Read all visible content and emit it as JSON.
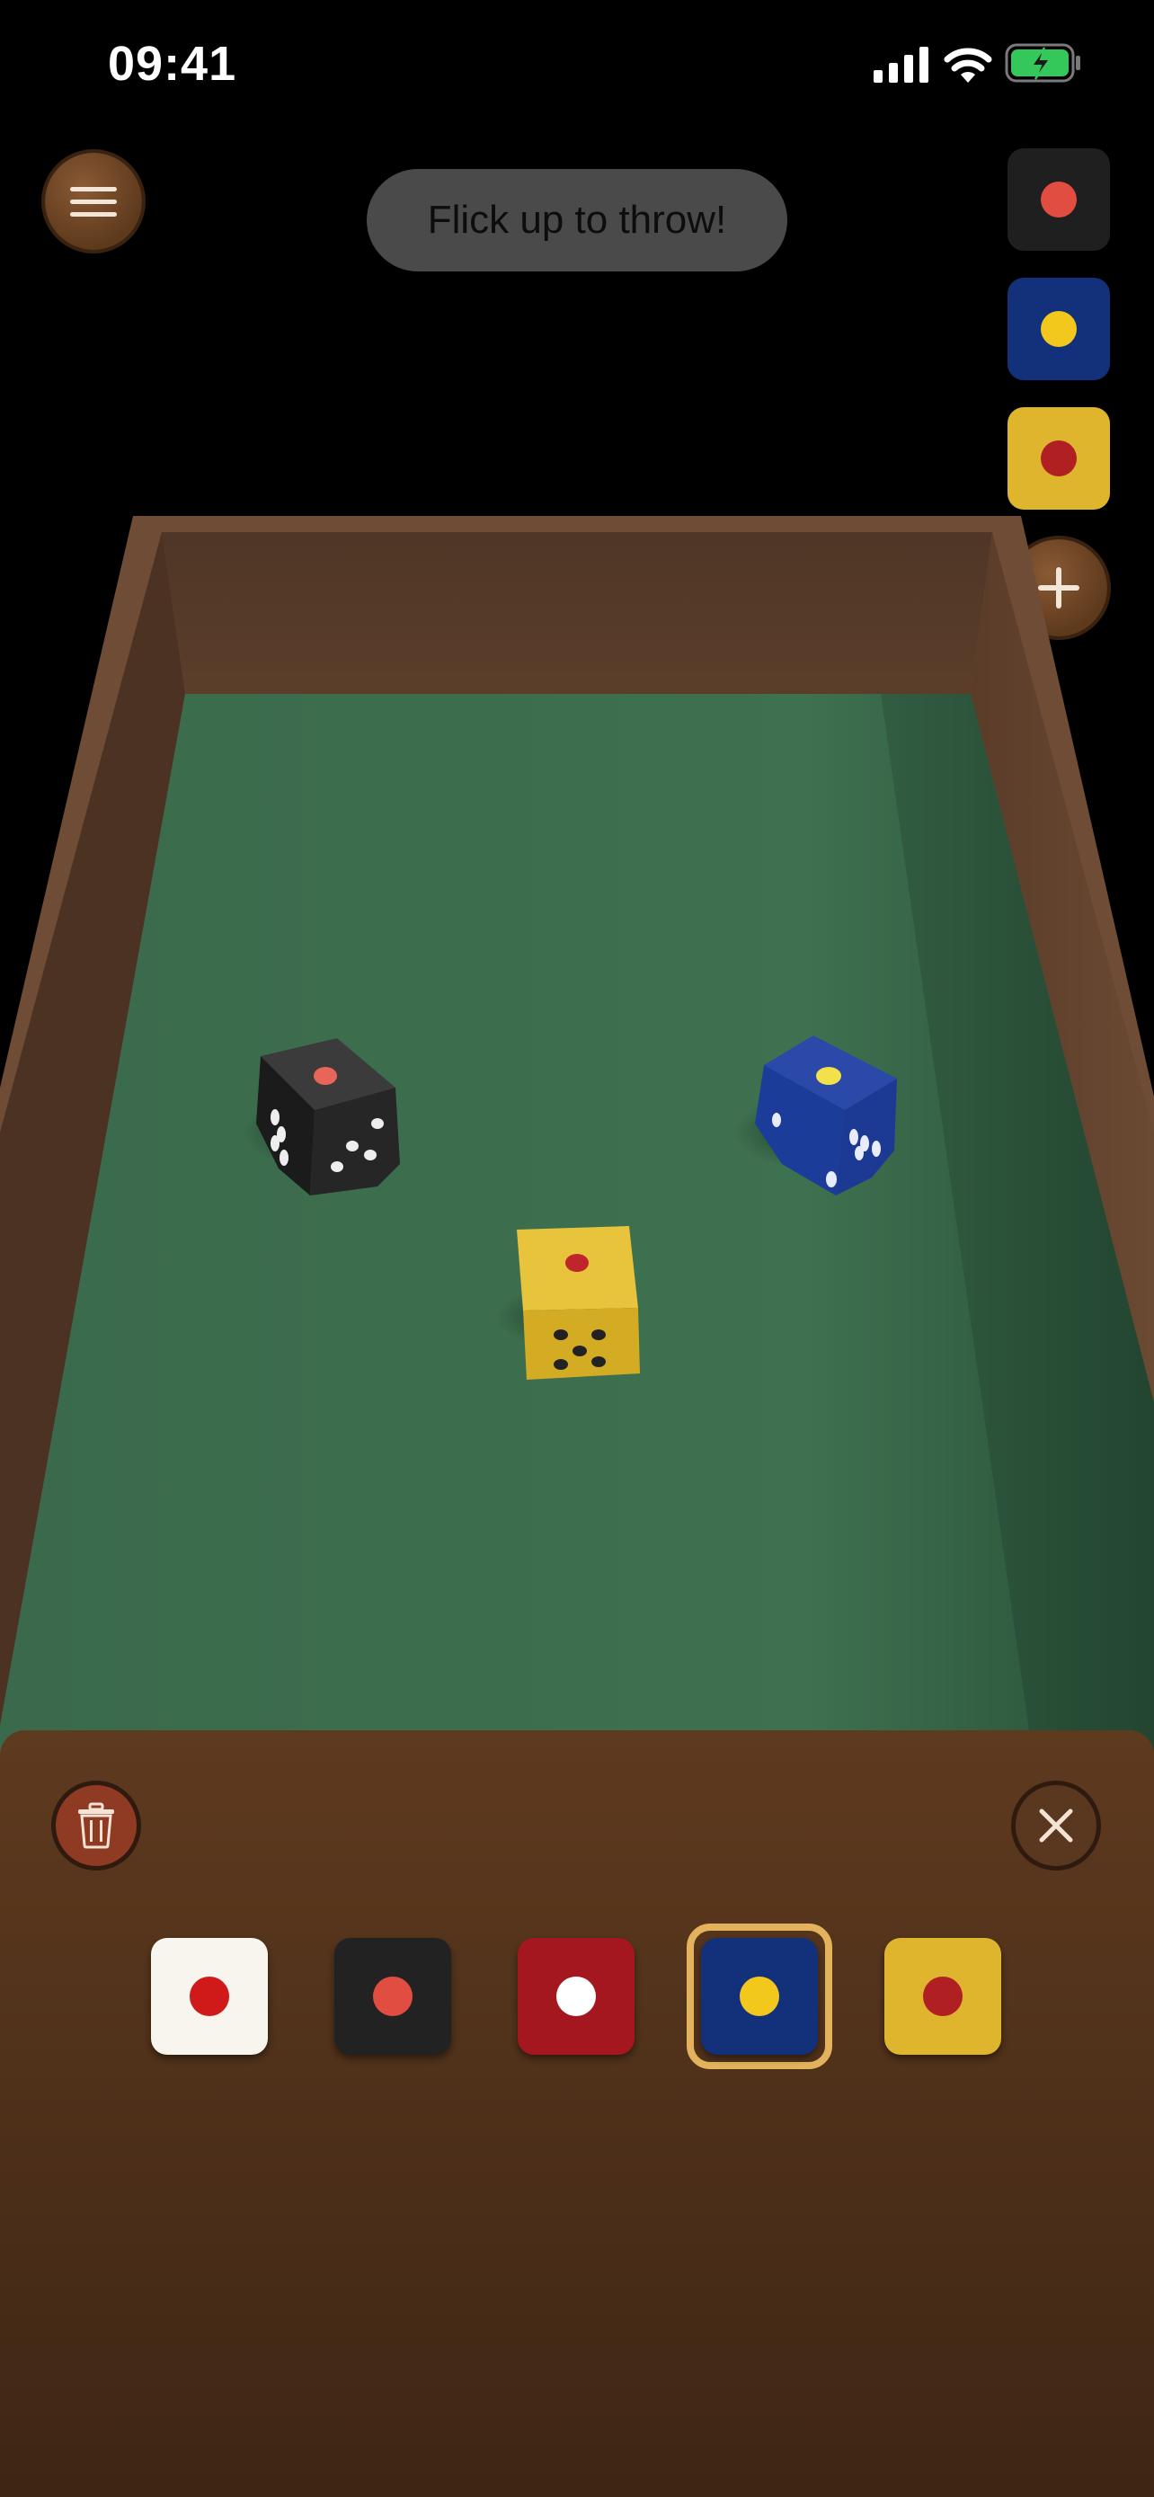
{
  "status_bar": {
    "time": "09:41"
  },
  "toast": {
    "text": "Flick up to throw!"
  },
  "colors": {
    "felt": "#3d6f4f",
    "wood": "#5e3a1f",
    "selection": "#e2b25c"
  },
  "active_dice": [
    {
      "name": "black",
      "face": "#222222",
      "pip": "#e24d42"
    },
    {
      "name": "blue",
      "face": "#13307a",
      "pip": "#f3c81c"
    },
    {
      "name": "yellow",
      "face": "#e0b52e",
      "pip": "#b01f22"
    }
  ],
  "palette": [
    {
      "name": "white",
      "face": "#f8f4ee",
      "pip": "#d01a1a",
      "selected": false
    },
    {
      "name": "black",
      "face": "#222222",
      "pip": "#e24d42",
      "selected": false
    },
    {
      "name": "red",
      "face": "#a5171f",
      "pip": "#ffffff",
      "selected": false
    },
    {
      "name": "blue",
      "face": "#13307a",
      "pip": "#f3c81c",
      "selected": true
    },
    {
      "name": "yellow",
      "face": "#e0b52e",
      "pip": "#b01f22",
      "selected": false
    }
  ],
  "icons": {
    "menu": "hamburger-icon",
    "add": "plus-icon",
    "delete": "trash-icon",
    "close": "close-icon"
  }
}
